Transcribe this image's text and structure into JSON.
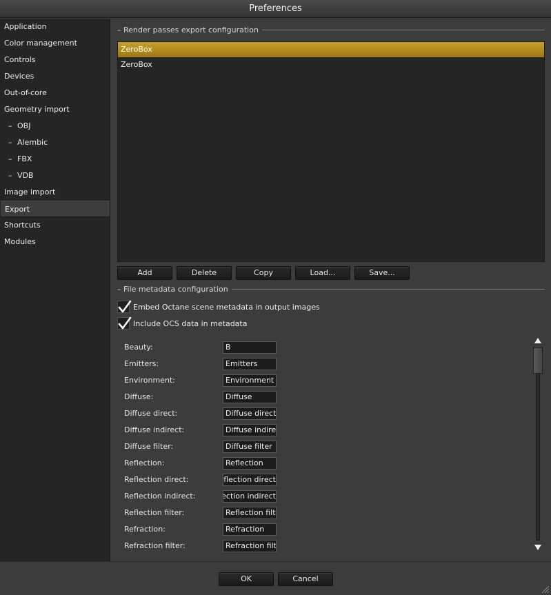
{
  "window": {
    "title": "Preferences"
  },
  "sidebar": {
    "items": [
      {
        "label": "Application",
        "sub": false
      },
      {
        "label": "Color management",
        "sub": false
      },
      {
        "label": "Controls",
        "sub": false
      },
      {
        "label": "Devices",
        "sub": false
      },
      {
        "label": "Out-of-core",
        "sub": false
      },
      {
        "label": "Geometry import",
        "sub": false
      },
      {
        "label": "OBJ",
        "sub": true
      },
      {
        "label": "Alembic",
        "sub": true
      },
      {
        "label": "FBX",
        "sub": true
      },
      {
        "label": "VDB",
        "sub": true
      },
      {
        "label": "Image import",
        "sub": false
      },
      {
        "label": "Export",
        "sub": false,
        "selected": true
      },
      {
        "label": "Shortcuts",
        "sub": false
      },
      {
        "label": "Modules",
        "sub": false
      }
    ]
  },
  "render_passes": {
    "title": "Render passes export configuration",
    "list": [
      {
        "label": "ZeroBox",
        "selected": true
      },
      {
        "label": "ZeroBox",
        "selected": false
      }
    ],
    "buttons": {
      "add": "Add",
      "delete": "Delete",
      "copy": "Copy",
      "load": "Load...",
      "save": "Save..."
    }
  },
  "file_metadata": {
    "title": "File metadata configuration",
    "embed_label": "Embed Octane scene metadata in output images",
    "embed_checked": true,
    "include_ocs_label": "Include OCS data in metadata",
    "include_ocs_checked": true,
    "passes": [
      {
        "label": "Beauty:",
        "value": "B"
      },
      {
        "label": "Emitters:",
        "value": "Emitters"
      },
      {
        "label": "Environment:",
        "value": "Environment"
      },
      {
        "label": "Diffuse:",
        "value": "Diffuse"
      },
      {
        "label": "Diffuse direct:",
        "value": "Diffuse direct"
      },
      {
        "label": "Diffuse indirect:",
        "value": "Diffuse indirect"
      },
      {
        "label": "Diffuse filter:",
        "value": "Diffuse filter"
      },
      {
        "label": "Reflection:",
        "value": "Reflection"
      },
      {
        "label": "Reflection direct:",
        "value": "Reflection direct"
      },
      {
        "label": "Reflection indirect:",
        "value": "Reflection indirect"
      },
      {
        "label": "Reflection filter:",
        "value": "Reflection filter"
      },
      {
        "label": "Refraction:",
        "value": "Refraction"
      },
      {
        "label": "Refraction filter:",
        "value": "Refraction filter"
      }
    ]
  },
  "dialog": {
    "ok": "OK",
    "cancel": "Cancel"
  },
  "colors": {
    "accent": "#b8961c",
    "background": "#3c3c3c",
    "panel": "#252525"
  }
}
